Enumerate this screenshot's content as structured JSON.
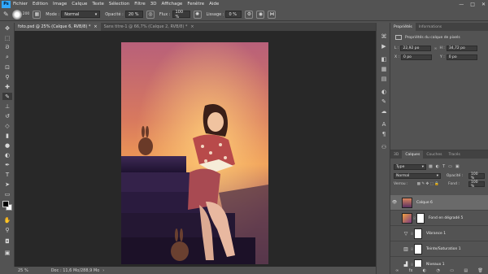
{
  "app": {
    "logo": "Ps"
  },
  "menu": [
    "Fichier",
    "Edition",
    "Image",
    "Calque",
    "Texte",
    "Sélection",
    "Filtre",
    "3D",
    "Affichage",
    "Fenêtre",
    "Aide"
  ],
  "window_controls": {
    "minimize": "—",
    "maximize": "□",
    "close": "✕"
  },
  "options": {
    "brush_size": "200",
    "mode_label": "Mode :",
    "mode_value": "Normal",
    "opacity_label": "Opacité :",
    "opacity_value": "20 %",
    "flow_label": "Flux :",
    "flow_value": "100 %",
    "smoothing_label": "Lissage :",
    "smoothing_value": "0 %"
  },
  "tabs": [
    {
      "label": "foto.psd @ 25% (Calque 6, RVB/8) *",
      "close": "×"
    },
    {
      "label": "Sans titre-1 @ 66,7% (Calque 2, RVB/8) *",
      "close": "×"
    }
  ],
  "status": {
    "zoom": "25 %",
    "doc": "Doc : 11,6 Mo/288,9 Mo",
    "arrow": "›"
  },
  "properties": {
    "tabs": [
      "Propriétés",
      "Informations"
    ],
    "title": "Propriétés du calque de pixels",
    "w_label": "L :",
    "w_value": "22,92 po",
    "h_label": "H :",
    "h_value": "34,72 po",
    "x_label": "X :",
    "x_value": "0 po",
    "y_label": "Y :",
    "y_value": "0 po",
    "link": "∞"
  },
  "layers_panel": {
    "tabs": [
      "3D",
      "Calques",
      "Couches",
      "Tracés"
    ],
    "kind_label": "Type",
    "blend_mode": "Normal",
    "opacity_label": "Opacité :",
    "opacity_value": "100 %",
    "lock_label": "Verrou :",
    "fill_label": "Fond :",
    "fill_value": "100 %",
    "layers": [
      {
        "name": "Calque 6",
        "visible": "👁",
        "kind": "pixel"
      },
      {
        "name": "Fond en dégradé 5",
        "visible": "",
        "kind": "gradient"
      },
      {
        "name": "Vibrance 1",
        "visible": "",
        "kind": "vibrance"
      },
      {
        "name": "Teinte/Saturation 1",
        "visible": "",
        "kind": "huesat"
      },
      {
        "name": "Niveaux 1",
        "visible": "",
        "kind": "levels"
      }
    ],
    "footer_icons": [
      "∞",
      "fx",
      "◐",
      "◔",
      "▭",
      "▤",
      "🗑"
    ]
  },
  "colors": {
    "ui_bg": "#535353",
    "canvas_bg": "#282828",
    "accent": "#31a8ff"
  }
}
